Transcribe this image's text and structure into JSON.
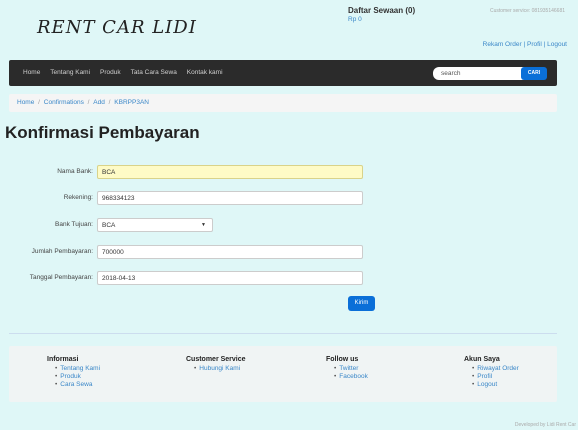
{
  "header": {
    "logo": "RENT CAR LIDI",
    "cart_title": "Daftar Sewaan (0)",
    "cart_total": "Rp 0",
    "customer_service": "Customer service: 081935146681",
    "toplinks": [
      "Rekam Order",
      "Profil",
      "Logout"
    ]
  },
  "nav": {
    "items": [
      "Home",
      "Tentang Kami",
      "Produk",
      "Tata Cara Sewa",
      "Kontak kami"
    ],
    "search_placeholder": "search",
    "search_button": "CARI"
  },
  "breadcrumb": [
    "Home",
    "Confirmations",
    "Add",
    "KBRPP3AN"
  ],
  "page_title": "Konfirmasi Pembayaran",
  "form": {
    "nama_bank": {
      "label": "Nama Bank:",
      "value": "BCA"
    },
    "rekening": {
      "label": "Rekening:",
      "value": "968334123"
    },
    "bank_tujuan": {
      "label": "Bank Tujuan:",
      "value": "BCA"
    },
    "jumlah": {
      "label": "Jumlah Pembayaran:",
      "value": "700000"
    },
    "tanggal": {
      "label": "Tanggal Pembayaran:",
      "value": "2018-04-13"
    },
    "submit": "Kirim"
  },
  "footer": {
    "informasi": {
      "title": "Informasi",
      "items": [
        "Tentang Kami",
        "Produk",
        "Cara Sewa"
      ]
    },
    "customer_service": {
      "title": "Customer Service",
      "items": [
        "Hubungi Kami"
      ]
    },
    "follow": {
      "title": "Follow us",
      "items": [
        "Twitter",
        "Facebook"
      ]
    },
    "akun": {
      "title": "Akun Saya",
      "items": [
        "Riwayat Order",
        "Profil",
        "Logout"
      ]
    }
  },
  "developed_by": "Developed by Lidi Rent Car"
}
